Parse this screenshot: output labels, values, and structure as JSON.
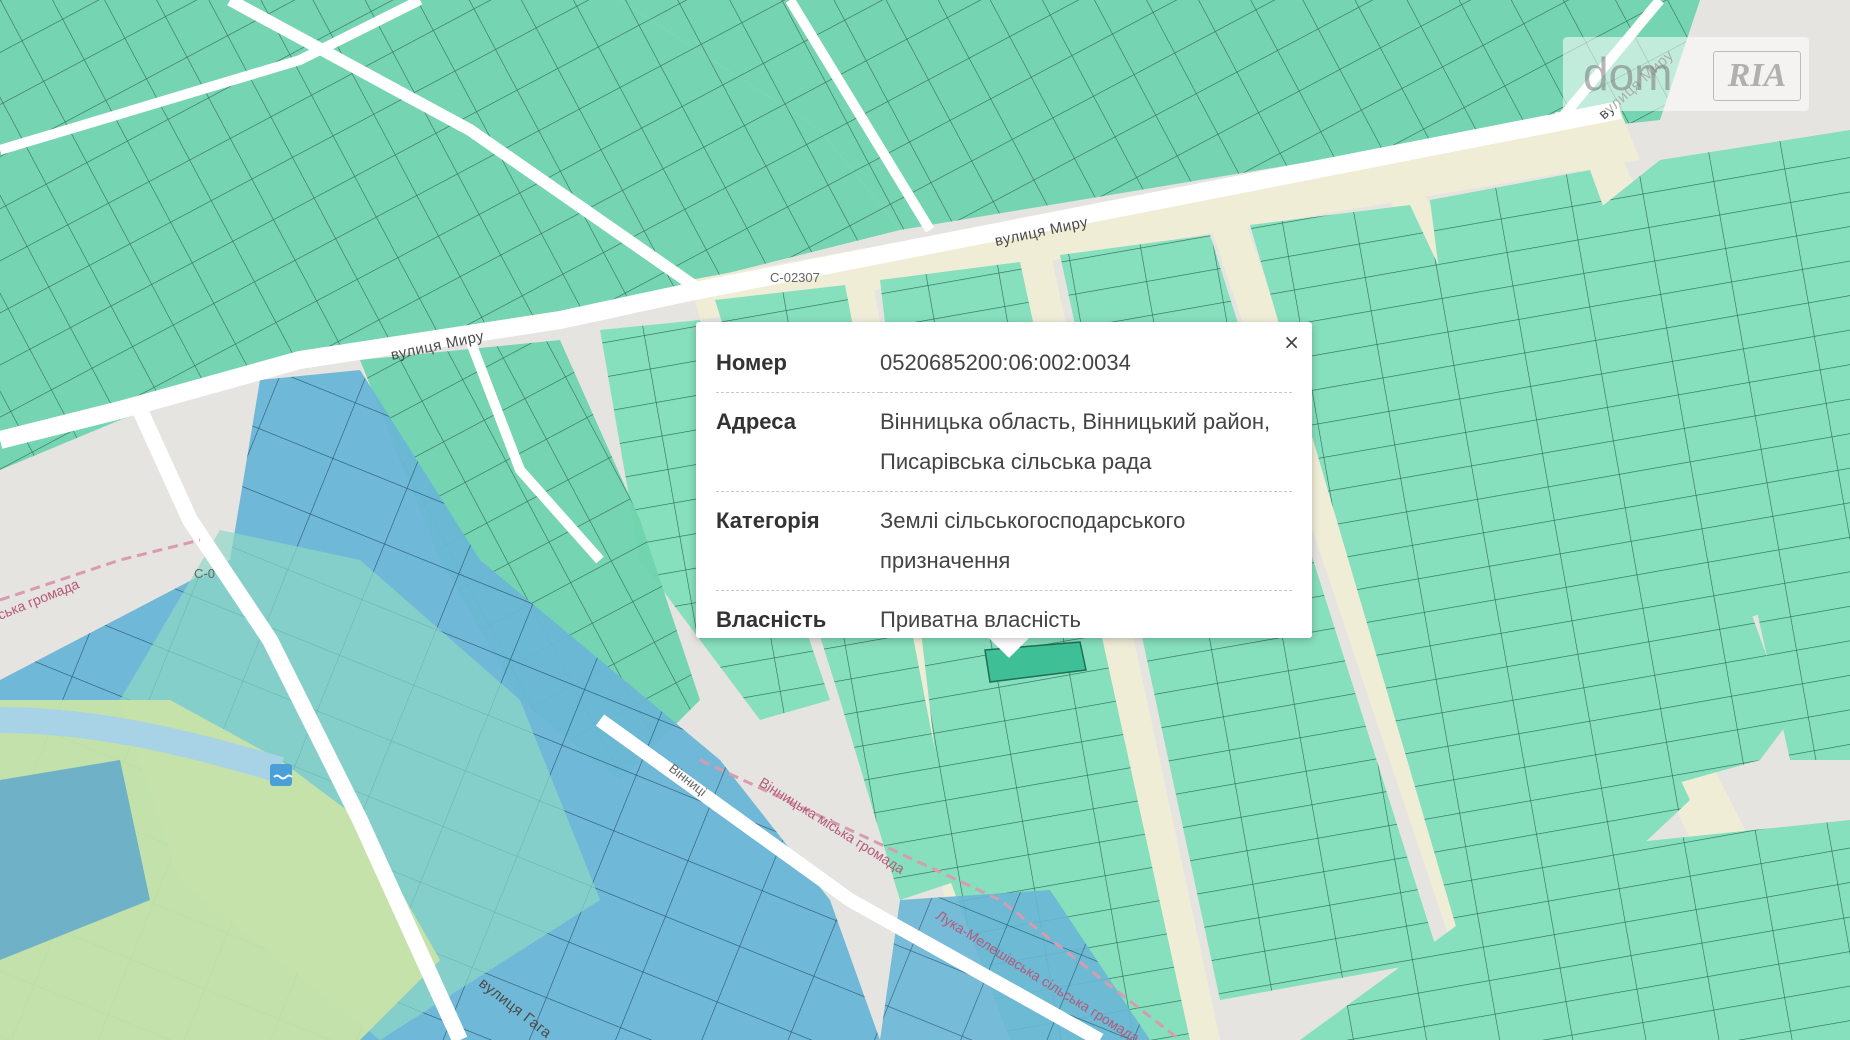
{
  "map": {
    "streets": {
      "miru_east": "вулиця Миру",
      "miru_west": "вулиця Миру",
      "miru_north": "вулиця Миру",
      "gagarina": "вулиця Гага",
      "vinnytski": "Вінниці"
    },
    "road_codes": {
      "c0": "C-0",
      "c02307": "C-02307"
    },
    "boundaries": {
      "vinnytska": "Вінницька міська громада",
      "luka": "Лука-Мелешівська сільська громада",
      "ska": "ська громада"
    },
    "colors": {
      "background": "#e6e4e0",
      "parcel_green": "#5ccfa6",
      "parcel_blue": "#5aa6cf",
      "parcel_selected": "#3fbf95",
      "road": "#ffffff",
      "path_beige": "#efedd6",
      "park": "#c7e3a8"
    }
  },
  "popup": {
    "close_label": "×",
    "rows": [
      {
        "key": "Номер",
        "value": "0520685200:06:002:0034"
      },
      {
        "key": "Адреса",
        "value": "Вінницька область, Вінницький район, Писарівська сільська рада"
      },
      {
        "key": "Категорія",
        "value": "Землі сільськогосподарського призначення"
      },
      {
        "key": "Власність",
        "value": "Приватна власність"
      }
    ]
  },
  "watermark": {
    "dom": "dom",
    "ria": "RIA"
  }
}
